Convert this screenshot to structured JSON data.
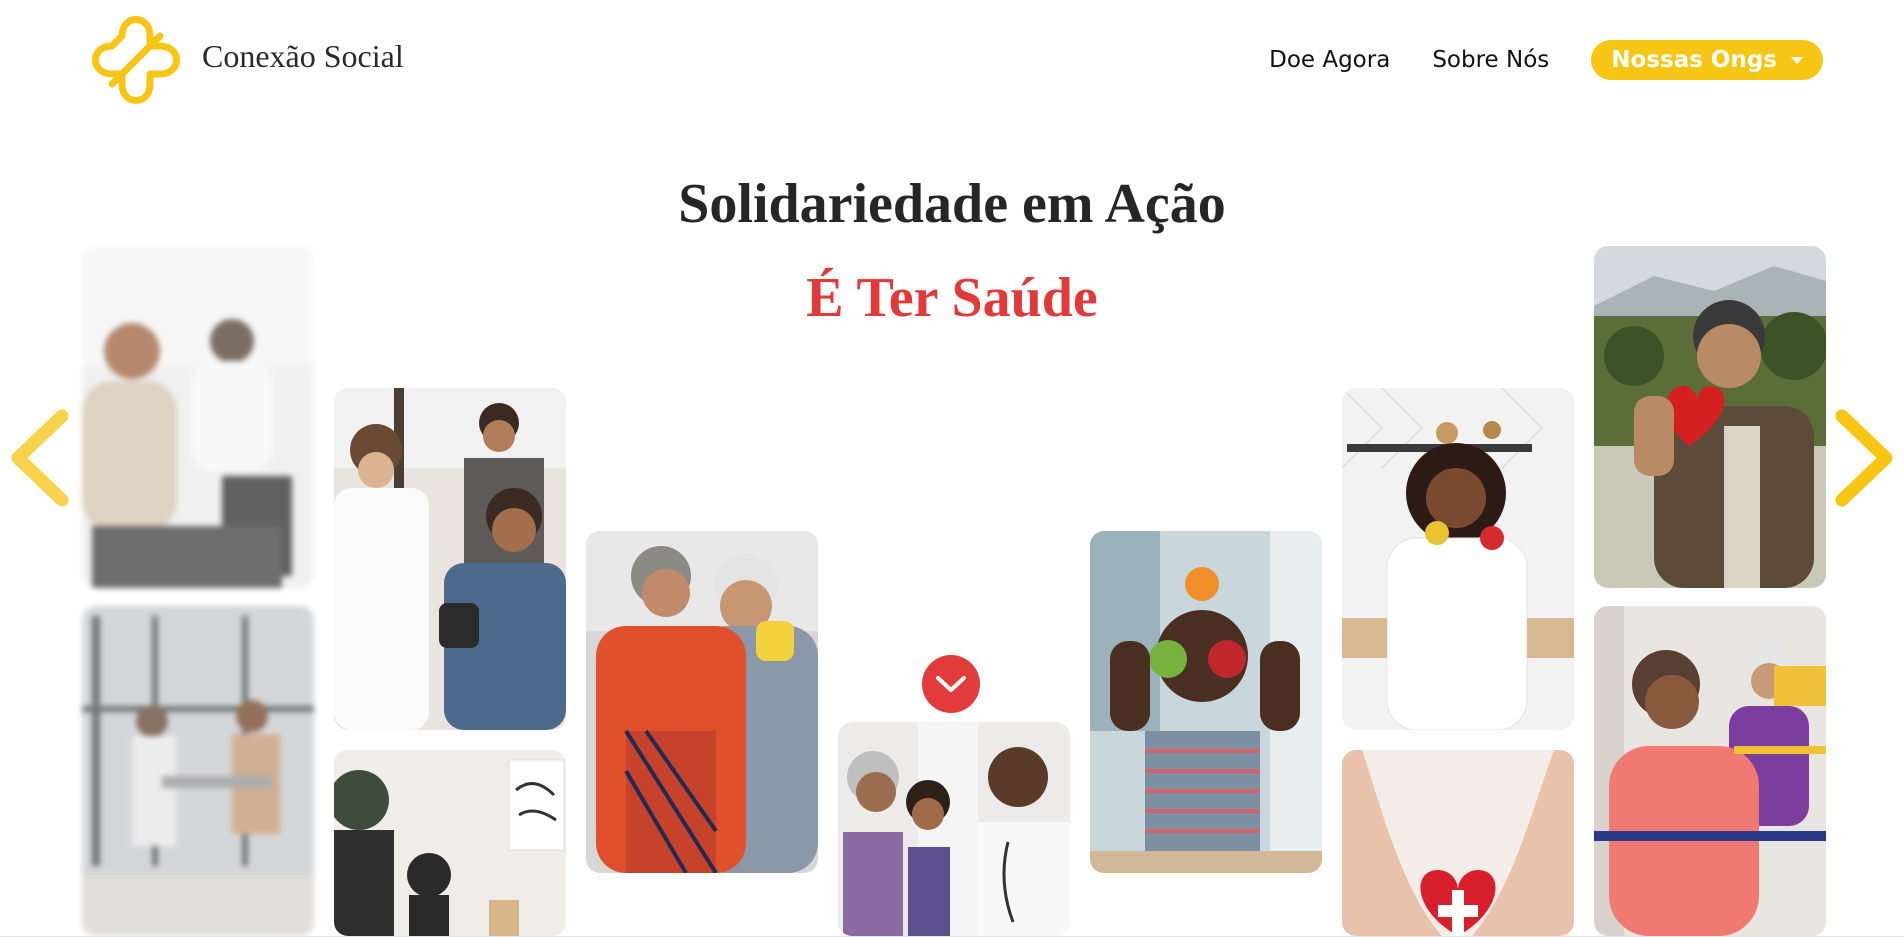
{
  "header": {
    "brand": "Conexão Social",
    "logo_icon": "cross-logo-icon",
    "nav": {
      "donate": "Doe Agora",
      "about": "Sobre Nós",
      "ongs_dropdown": "Nossas Ongs"
    }
  },
  "hero": {
    "title": "Solidariedade em Ação",
    "subtitle": "É Ter Saúde"
  },
  "carousel": {
    "prev_icon": "chevron-left-icon",
    "next_icon": "chevron-right-icon",
    "scroll_icon": "chevron-down-icon",
    "photos": [
      "doctor consultation photo",
      "blood pressure check photo",
      "elderly couple hugging photo",
      "doctor with family photo",
      "woman with apples photo",
      "woman holding peppers photo",
      "elderly man holding heart photo"
    ]
  },
  "colors": {
    "accent_yellow": "#f7c614",
    "accent_red": "#e03a3a",
    "text_dark": "#262626"
  }
}
